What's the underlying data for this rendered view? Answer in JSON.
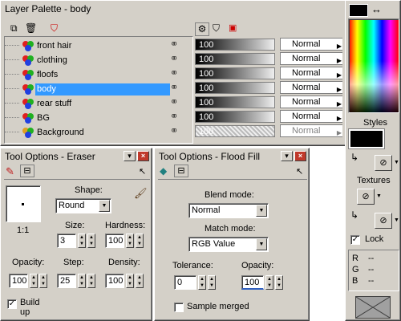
{
  "layer_palette": {
    "title": "Layer Palette - body",
    "layers": [
      {
        "name": "front hair",
        "opacity": "100",
        "blend": "Normal",
        "selected": false,
        "colors": [
          "#e02020",
          "#20b020",
          "#2040e0"
        ]
      },
      {
        "name": "clothing",
        "opacity": "100",
        "blend": "Normal",
        "selected": false,
        "colors": [
          "#e02020",
          "#20b020",
          "#2040e0"
        ]
      },
      {
        "name": "floofs",
        "opacity": "100",
        "blend": "Normal",
        "selected": false,
        "colors": [
          "#e02020",
          "#20b020",
          "#2040e0"
        ]
      },
      {
        "name": "body",
        "opacity": "100",
        "blend": "Normal",
        "selected": true,
        "colors": [
          "#e02020",
          "#20b020",
          "#2040e0"
        ]
      },
      {
        "name": "rear stuff",
        "opacity": "100",
        "blend": "Normal",
        "selected": false,
        "colors": [
          "#e02020",
          "#20b020",
          "#2040e0"
        ]
      },
      {
        "name": "BG",
        "opacity": "100",
        "blend": "Normal",
        "selected": false,
        "colors": [
          "#e02020",
          "#20b020",
          "#2040e0"
        ]
      },
      {
        "name": "Background",
        "opacity": "100",
        "blend": "Normal",
        "selected": false,
        "colors": [
          "#e0a020",
          "#20b020",
          "#2040e0"
        ]
      }
    ]
  },
  "eraser": {
    "title": "Tool Options - Eraser",
    "preview_ratio": "1:1",
    "shape_label": "Shape:",
    "shape_value": "Round",
    "size_label": "Size:",
    "size_value": "3",
    "hardness_label": "Hardness:",
    "hardness_value": "100",
    "opacity_label": "Opacity:",
    "opacity_value": "100",
    "step_label": "Step:",
    "step_value": "25",
    "density_label": "Density:",
    "density_value": "100",
    "buildup_label": "Build up",
    "buildup_checked": true
  },
  "flood_fill": {
    "title": "Tool Options - Flood Fill",
    "blend_label": "Blend mode:",
    "blend_value": "Normal",
    "match_label": "Match mode:",
    "match_value": "RGB Value",
    "tolerance_label": "Tolerance:",
    "tolerance_value": "0",
    "opacity_label": "Opacity:",
    "opacity_value": "100",
    "sample_label": "Sample merged",
    "sample_checked": false
  },
  "color_panel": {
    "styles_label": "Styles",
    "textures_label": "Textures",
    "lock_label": "Lock",
    "lock_checked": true,
    "r_label": "R",
    "g_label": "G",
    "b_label": "B",
    "r_value": "--",
    "g_value": "--",
    "b_value": "--",
    "swap_glyph": "↔"
  }
}
